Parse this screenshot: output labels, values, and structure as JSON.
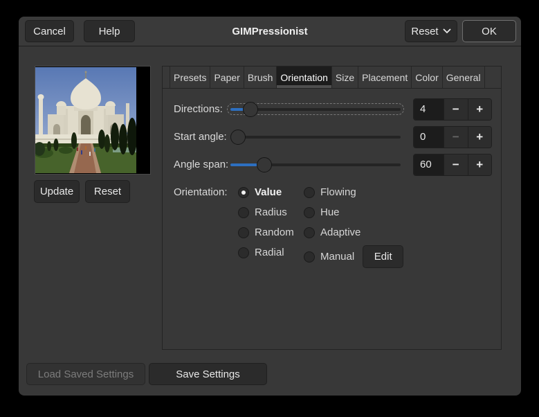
{
  "window": {
    "title": "GIMPressionist"
  },
  "header": {
    "cancel": "Cancel",
    "help": "Help",
    "reset": "Reset",
    "ok": "OK"
  },
  "icons": {
    "reset_dropdown": "chevron-down-icon",
    "spin_minus": "minus-icon",
    "spin_plus": "plus-icon"
  },
  "preview": {
    "image": "taj-mahal-photo",
    "update": "Update",
    "reset": "Reset"
  },
  "tabs": [
    {
      "label": "Presets",
      "active": false
    },
    {
      "label": "Paper",
      "active": false
    },
    {
      "label": "Brush",
      "active": false
    },
    {
      "label": "Orientation",
      "active": true
    },
    {
      "label": "Size",
      "active": false
    },
    {
      "label": "Placement",
      "active": false
    },
    {
      "label": "Color",
      "active": false
    },
    {
      "label": "General",
      "active": false
    }
  ],
  "sliders": [
    {
      "label": "Directions:",
      "value": "4",
      "percent": 8,
      "focused": true,
      "minus_disabled": false
    },
    {
      "label": "Start angle:",
      "value": "0",
      "percent": 0,
      "focused": false,
      "minus_disabled": true
    },
    {
      "label": "Angle span:",
      "value": "60",
      "percent": 17,
      "focused": false,
      "minus_disabled": false
    }
  ],
  "spin": {
    "minus": "−",
    "plus": "+"
  },
  "orientation": {
    "label": "Orientation:",
    "options": [
      {
        "label": "Value",
        "selected": true
      },
      {
        "label": "Flowing",
        "selected": false
      },
      {
        "label": "Radius",
        "selected": false
      },
      {
        "label": "Hue",
        "selected": false
      },
      {
        "label": "Random",
        "selected": false
      },
      {
        "label": "Adaptive",
        "selected": false
      },
      {
        "label": "Radial",
        "selected": false
      },
      {
        "label": "Manual",
        "selected": false
      }
    ],
    "edit": "Edit"
  },
  "footer": {
    "load": "Load Saved Settings",
    "load_disabled": true,
    "save": "Save Settings"
  },
  "colors": {
    "accent_blue": "#2d6fc0",
    "dialog_bg": "#383838",
    "entry_bg": "#1c1c1c",
    "active_tab_bg": "#1c1c1c",
    "active_tab_underline": "#4f4f4f",
    "text": "#e8e8e8",
    "disabled_text": "#7c7c7c"
  }
}
